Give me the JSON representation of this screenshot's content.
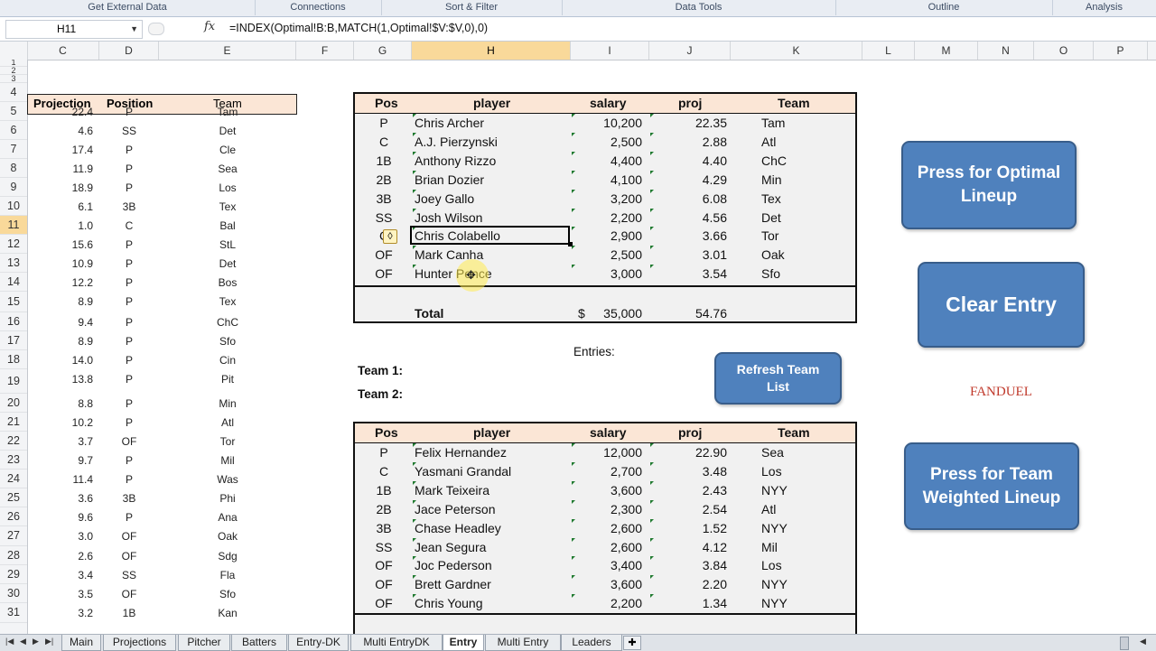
{
  "ribbon": {
    "groups": [
      "Get External Data",
      "Connections",
      "Sort & Filter",
      "Data Tools",
      "Outline",
      "Analysis"
    ]
  },
  "formula_bar": {
    "name_box": "H11",
    "fx_symbol": "fx",
    "formula": "=INDEX(Optimal!B:B,MATCH(1,Optimal!$V:$V,0),0)"
  },
  "columns": [
    "C",
    "D",
    "E",
    "F",
    "G",
    "H",
    "I",
    "J",
    "K",
    "L",
    "M",
    "N",
    "O",
    "P"
  ],
  "selected_column": "H",
  "rows": [
    "1",
    "2",
    "3",
    "4",
    "5",
    "6",
    "7",
    "8",
    "9",
    "10",
    "11",
    "12",
    "13",
    "14",
    "15",
    "16",
    "17",
    "18",
    "19",
    "20",
    "21",
    "22",
    "23",
    "24",
    "25",
    "26",
    "27",
    "28",
    "29",
    "30",
    "31"
  ],
  "selected_row": "11",
  "projections": {
    "headers": {
      "projection": "Projection",
      "position": "Position",
      "team": "Team"
    },
    "rows": [
      {
        "proj": "22.4",
        "pos": "P",
        "team": "Tam"
      },
      {
        "proj": "4.6",
        "pos": "SS",
        "team": "Det"
      },
      {
        "proj": "17.4",
        "pos": "P",
        "team": "Cle"
      },
      {
        "proj": "11.9",
        "pos": "P",
        "team": "Sea"
      },
      {
        "proj": "18.9",
        "pos": "P",
        "team": "Los"
      },
      {
        "proj": "6.1",
        "pos": "3B",
        "team": "Tex"
      },
      {
        "proj": "1.0",
        "pos": "C",
        "team": "Bal"
      },
      {
        "proj": "15.6",
        "pos": "P",
        "team": "StL"
      },
      {
        "proj": "10.9",
        "pos": "P",
        "team": "Det"
      },
      {
        "proj": "12.2",
        "pos": "P",
        "team": "Bos"
      },
      {
        "proj": "8.9",
        "pos": "P",
        "team": "Tex"
      },
      {
        "proj": "9.4",
        "pos": "P",
        "team": "ChC"
      },
      {
        "proj": "8.9",
        "pos": "P",
        "team": "Sfo"
      },
      {
        "proj": "14.0",
        "pos": "P",
        "team": "Cin"
      },
      {
        "proj": "13.8",
        "pos": "P",
        "team": "Pit"
      },
      {
        "proj": "8.8",
        "pos": "P",
        "team": "Min"
      },
      {
        "proj": "10.2",
        "pos": "P",
        "team": "Atl"
      },
      {
        "proj": "3.7",
        "pos": "OF",
        "team": "Tor"
      },
      {
        "proj": "9.7",
        "pos": "P",
        "team": "Mil"
      },
      {
        "proj": "11.4",
        "pos": "P",
        "team": "Was"
      },
      {
        "proj": "3.6",
        "pos": "3B",
        "team": "Phi"
      },
      {
        "proj": "9.6",
        "pos": "P",
        "team": "Ana"
      },
      {
        "proj": "3.0",
        "pos": "OF",
        "team": "Oak"
      },
      {
        "proj": "2.6",
        "pos": "OF",
        "team": "Sdg"
      },
      {
        "proj": "3.4",
        "pos": "SS",
        "team": "Fla"
      },
      {
        "proj": "3.5",
        "pos": "OF",
        "team": "Sfo"
      },
      {
        "proj": "3.2",
        "pos": "1B",
        "team": "Kan"
      }
    ]
  },
  "lineup1": {
    "headers": {
      "pos": "Pos",
      "player": "player",
      "salary": "salary",
      "proj": "proj",
      "team": "Team"
    },
    "rows": [
      {
        "pos": "P",
        "player": "Chris Archer",
        "salary": "10,200",
        "proj": "22.35",
        "team": "Tam"
      },
      {
        "pos": "C",
        "player": "A.J. Pierzynski",
        "salary": "2,500",
        "proj": "2.88",
        "team": "Atl"
      },
      {
        "pos": "1B",
        "player": "Anthony Rizzo",
        "salary": "4,400",
        "proj": "4.40",
        "team": "ChC"
      },
      {
        "pos": "2B",
        "player": "Brian Dozier",
        "salary": "4,100",
        "proj": "4.29",
        "team": "Min"
      },
      {
        "pos": "3B",
        "player": "Joey Gallo",
        "salary": "3,200",
        "proj": "6.08",
        "team": "Tex"
      },
      {
        "pos": "SS",
        "player": "Josh Wilson",
        "salary": "2,200",
        "proj": "4.56",
        "team": "Det"
      },
      {
        "pos": "C",
        "player": "Chris Colabello",
        "salary": "2,900",
        "proj": "3.66",
        "team": "Tor"
      },
      {
        "pos": "OF",
        "player": "Mark Canha",
        "salary": "2,500",
        "proj": "3.01",
        "team": "Oak"
      },
      {
        "pos": "OF",
        "player": "Hunter Pence",
        "salary": "3,000",
        "proj": "3.54",
        "team": "Sfo"
      }
    ],
    "total_label": "Total",
    "total_currency": "$",
    "total_salary": "35,000",
    "total_proj": "54.76"
  },
  "entries_label": "Entries:",
  "team1_label": "Team 1:",
  "team2_label": "Team 2:",
  "lineup2": {
    "headers": {
      "pos": "Pos",
      "player": "player",
      "salary": "salary",
      "proj": "proj",
      "team": "Team"
    },
    "rows": [
      {
        "pos": "P",
        "player": "Felix Hernandez",
        "salary": "12,000",
        "proj": "22.90",
        "team": "Sea"
      },
      {
        "pos": "C",
        "player": "Yasmani Grandal",
        "salary": "2,700",
        "proj": "3.48",
        "team": "Los"
      },
      {
        "pos": "1B",
        "player": "Mark Teixeira",
        "salary": "3,600",
        "proj": "2.43",
        "team": "NYY"
      },
      {
        "pos": "2B",
        "player": "Jace Peterson",
        "salary": "2,300",
        "proj": "2.54",
        "team": "Atl"
      },
      {
        "pos": "3B",
        "player": "Chase Headley",
        "salary": "2,600",
        "proj": "1.52",
        "team": "NYY"
      },
      {
        "pos": "SS",
        "player": "Jean Segura",
        "salary": "2,600",
        "proj": "4.12",
        "team": "Mil"
      },
      {
        "pos": "OF",
        "player": "Joc Pederson",
        "salary": "3,400",
        "proj": "3.84",
        "team": "Los"
      },
      {
        "pos": "OF",
        "player": "Brett Gardner",
        "salary": "3,600",
        "proj": "2.20",
        "team": "NYY"
      },
      {
        "pos": "OF",
        "player": "Chris Young",
        "salary": "2,200",
        "proj": "1.34",
        "team": "NYY"
      }
    ]
  },
  "buttons": {
    "optimal": "Press for Optimal Lineup",
    "clear": "Clear Entry",
    "refresh": "Refresh Team List",
    "weighted": "Press for Team Weighted Lineup"
  },
  "fanduel_label": "FANDUEL",
  "colors": {
    "header_fill": "#fbe6d6",
    "button_fill": "#4f81bd",
    "fanduel": "#c0392b"
  },
  "sheet_tabs": [
    "Main",
    "Projections",
    "Pitcher",
    "Batters",
    "Entry-DK",
    "Multi EntryDK",
    "Entry",
    "Multi Entry",
    "Leaders"
  ],
  "active_tab": "Entry"
}
